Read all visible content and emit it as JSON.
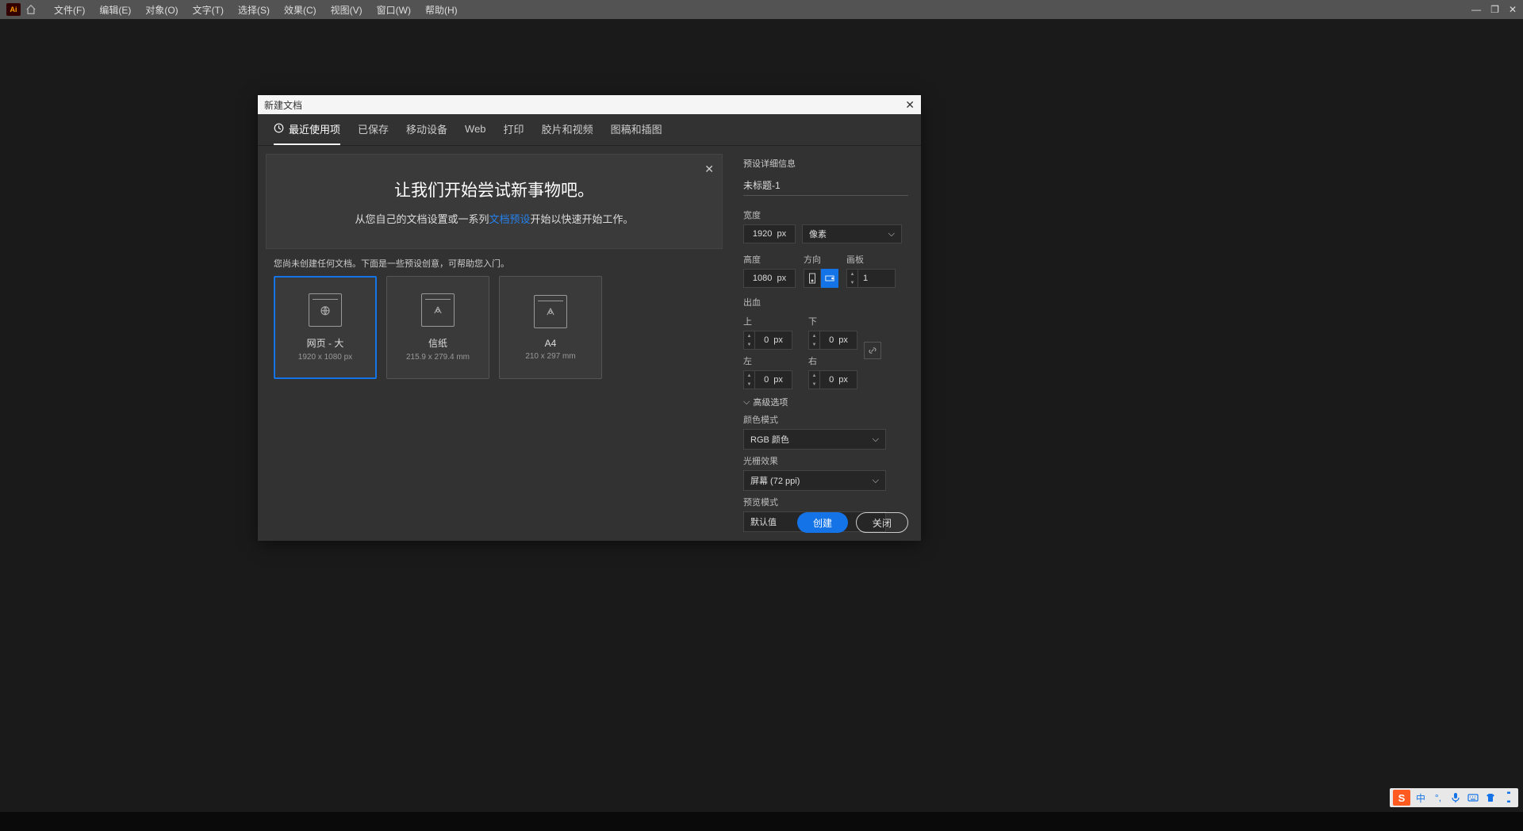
{
  "menubar": {
    "items": [
      "文件(F)",
      "编辑(E)",
      "对象(O)",
      "文字(T)",
      "选择(S)",
      "效果(C)",
      "视图(V)",
      "窗口(W)",
      "帮助(H)"
    ]
  },
  "dialog": {
    "title": "新建文档",
    "tabs": [
      "最近使用项",
      "已保存",
      "移动设备",
      "Web",
      "打印",
      "胶片和视频",
      "图稿和插图"
    ],
    "hero_title": "让我们开始尝试新事物吧。",
    "hero_sub_pre": "从您自己的文档设置或一系列",
    "hero_link": "文档预设",
    "hero_sub_post": "开始以快速开始工作。",
    "presets_hint": "您尚未创建任何文档。下面是一些预设创意，可帮助您入门。",
    "presets": [
      {
        "title": "网页 - 大",
        "dim": "1920 x 1080 px"
      },
      {
        "title": "信纸",
        "dim": "215.9 x 279.4 mm"
      },
      {
        "title": "A4",
        "dim": "210 x 297 mm"
      }
    ]
  },
  "panel": {
    "section_title": "预设详细信息",
    "name_value": "未标题-1",
    "width_label": "宽度",
    "width_value": "1920  px",
    "unit_value": "像素",
    "height_label": "高度",
    "height_value": "1080  px",
    "orient_label": "方向",
    "artboards_label": "画板",
    "artboards_value": "1",
    "bleed_label": "出血",
    "bleed": {
      "top_label": "上",
      "top_value": "0  px",
      "bottom_label": "下",
      "bottom_value": "0  px",
      "left_label": "左",
      "left_value": "0  px",
      "right_label": "右",
      "right_value": "0  px"
    },
    "advanced_label": "高级选项",
    "color_mode_label": "颜色模式",
    "color_mode_value": "RGB 颜色",
    "raster_label": "光栅效果",
    "raster_value": "屏幕 (72 ppi)",
    "preview_label": "预览模式",
    "preview_value": "默认值",
    "create_btn": "创建",
    "close_btn": "关闭"
  },
  "ime": {
    "lang": "中"
  }
}
